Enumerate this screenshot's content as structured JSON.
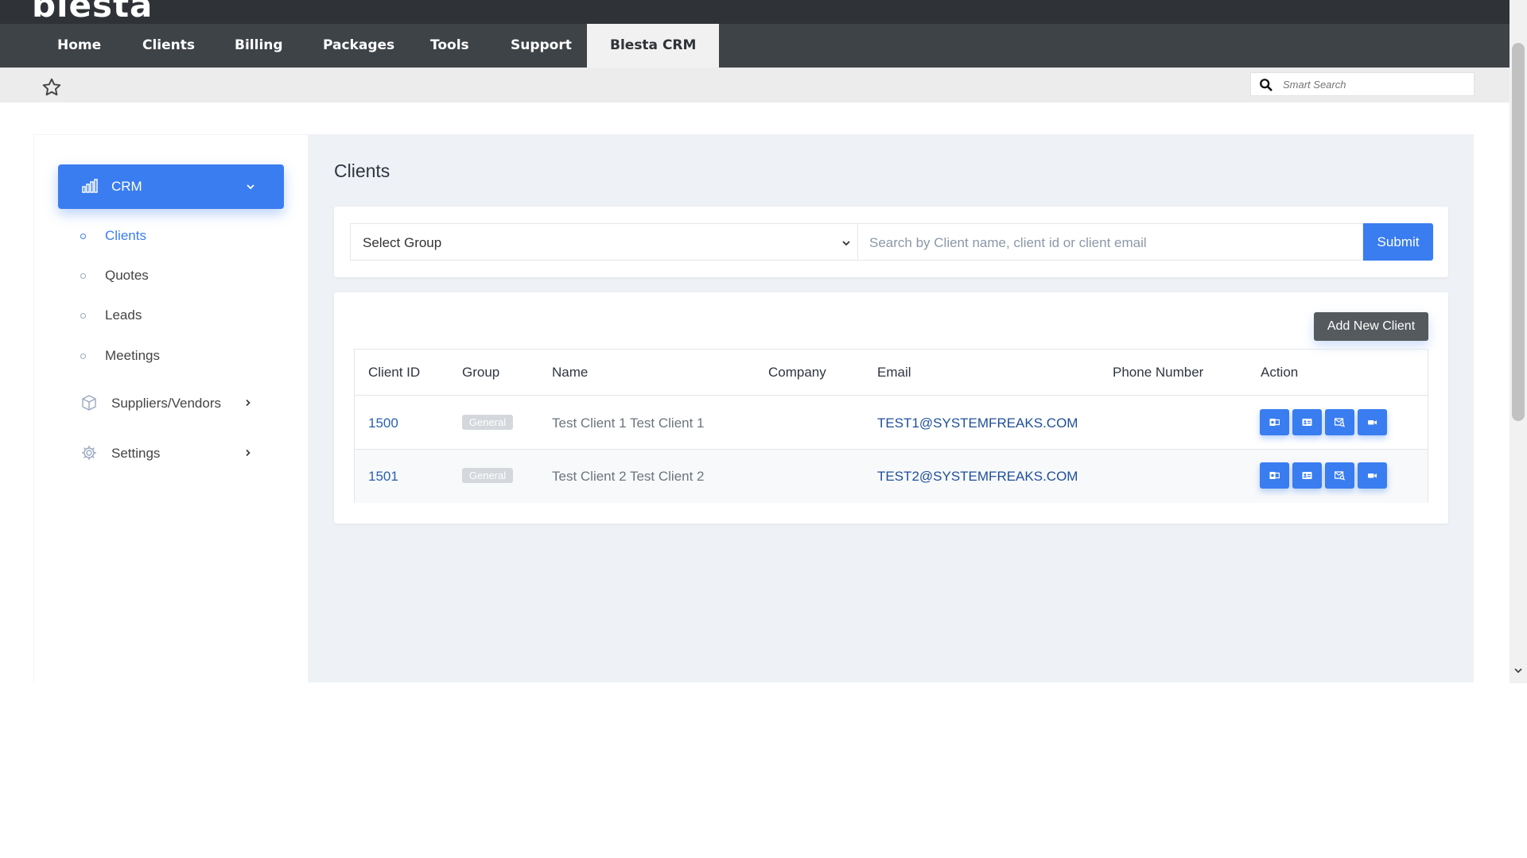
{
  "header": {
    "logo_text": "blesta",
    "nav": [
      {
        "label": "Home"
      },
      {
        "label": "Clients"
      },
      {
        "label": "Billing"
      },
      {
        "label": "Packages"
      },
      {
        "label": "Tools"
      },
      {
        "label": "Support"
      },
      {
        "label": "Blesta CRM",
        "active": true
      }
    ],
    "smart_search_placeholder": "Smart Search"
  },
  "sidebar": {
    "crm_label": "CRM",
    "sub_items": [
      {
        "label": "Clients",
        "active": true
      },
      {
        "label": "Quotes"
      },
      {
        "label": "Leads"
      },
      {
        "label": "Meetings"
      }
    ],
    "menu_items": [
      {
        "label": "Suppliers/Vendors",
        "icon": "box-icon"
      },
      {
        "label": "Settings",
        "icon": "gear-icon"
      }
    ]
  },
  "main": {
    "title": "Clients",
    "filter": {
      "select_label": "Select Group",
      "search_placeholder": "Search by Client name, client id or client email",
      "submit_label": "Submit"
    },
    "add_button_label": "Add New Client",
    "table": {
      "columns": [
        "Client ID",
        "Group",
        "Name",
        "Company",
        "Email",
        "Phone Number",
        "Action"
      ],
      "rows": [
        {
          "id": "1500",
          "group": "General",
          "name": "Test Client 1 Test Client 1",
          "company": "",
          "email": "TEST1@SYSTEMFREAKS.COM",
          "phone": ""
        },
        {
          "id": "1501",
          "group": "General",
          "name": "Test Client 2 Test Client 2",
          "company": "",
          "email": "TEST2@SYSTEMFREAKS.COM",
          "phone": ""
        }
      ],
      "actions": [
        "outlook-icon",
        "contact-card-icon",
        "email-search-icon",
        "video-icon"
      ]
    }
  },
  "colors": {
    "accent": "#3a7df0",
    "topbar": "#2f3337",
    "navbar": "#3e4347",
    "main_bg": "#eef1f5"
  }
}
